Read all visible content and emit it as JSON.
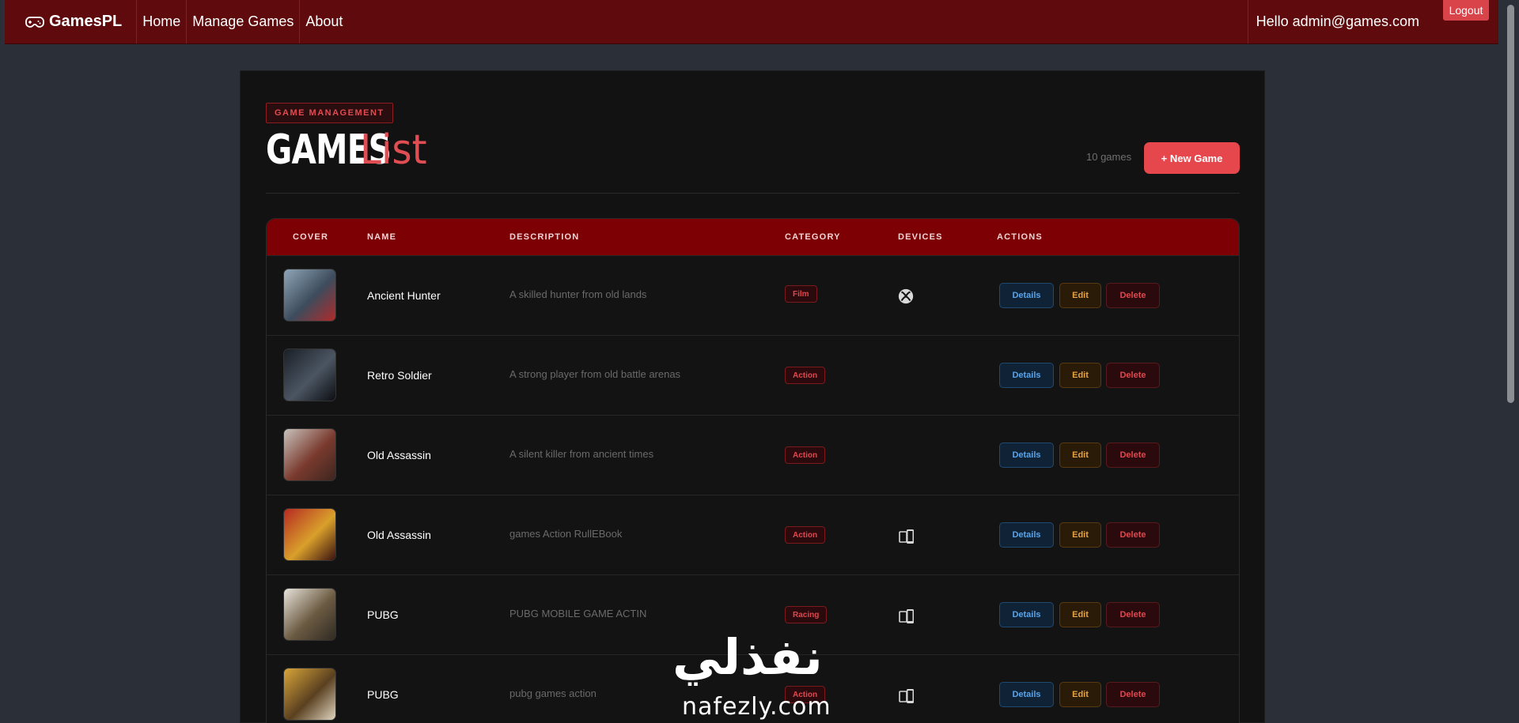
{
  "nav": {
    "brand": "GamesPL",
    "links": [
      "Home",
      "Manage Games",
      "About"
    ],
    "user_greeting": "Hello admin@games.com",
    "logout_label": "Logout"
  },
  "page": {
    "eyebrow": "GAME MANAGEMENT",
    "title_strong": "GAMES",
    "title_accent": "List",
    "count": "10 games",
    "new_game_label": "+ New Game"
  },
  "table": {
    "headers": {
      "cover": "COVER",
      "name": "NAME",
      "description": "DESCRIPTION",
      "category": "CATEGORY",
      "devices": "DEVICES",
      "actions": "ACTIONS"
    },
    "action_labels": {
      "details": "Details",
      "edit": "Edit",
      "delete": "Delete"
    },
    "rows": [
      {
        "name": "Ancient Hunter",
        "description": "A skilled hunter from old lands",
        "category": "Film",
        "device": "xbox-icon",
        "cover_colors": [
          "#8fa6b8",
          "#3d4c5c",
          "#b02a2a"
        ]
      },
      {
        "name": "Retro Soldier",
        "description": "A strong player from old battle arenas",
        "category": "Action",
        "device": "",
        "cover_colors": [
          "#1a1f26",
          "#4b5562",
          "#0c0e12"
        ]
      },
      {
        "name": "Old Assassin",
        "description": "A silent killer from ancient times",
        "category": "Action",
        "device": "",
        "cover_colors": [
          "#c8c2bb",
          "#7a3a2e",
          "#3c2620"
        ]
      },
      {
        "name": "Old Assassin",
        "description": "games Action RullEBook",
        "category": "Action",
        "device": "mobile-icon",
        "cover_colors": [
          "#b52a22",
          "#d9a02b",
          "#3a1210"
        ]
      },
      {
        "name": "PUBG",
        "description": "PUBG MOBILE GAME ACTIN",
        "category": "Racing",
        "device": "mobile-icon",
        "cover_colors": [
          "#e8e3da",
          "#6b5a42",
          "#2f2a22"
        ]
      },
      {
        "name": "PUBG",
        "description": "pubg games action",
        "category": "Action",
        "device": "mobile-icon",
        "cover_colors": [
          "#d9a63a",
          "#5a4020",
          "#e0d5c0"
        ]
      }
    ]
  },
  "watermark": {
    "arabic": "نفذلي",
    "latin": "nafezly.com"
  }
}
